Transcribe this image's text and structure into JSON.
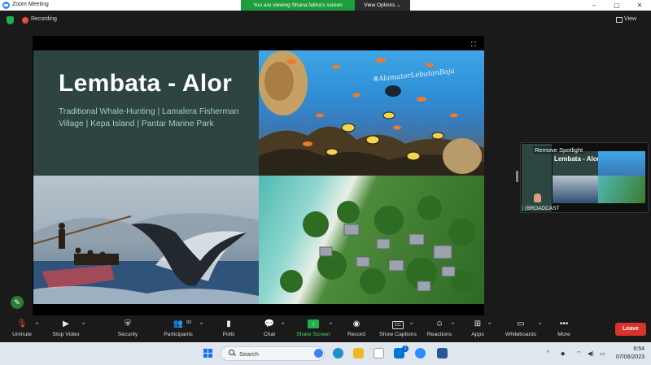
{
  "window": {
    "title": "Zoom Meeting"
  },
  "banner": {
    "text": "You are viewing Shana fatina's screen",
    "options_label": "View Options"
  },
  "status": {
    "recording_label": "Recording",
    "view_label": "View"
  },
  "slide": {
    "title": "Lembata - Alor",
    "subtitle": "Traditional Whale-Hunting | Lamalera Fisherman Village | Kepa Island | Pantar Marine Park",
    "reef_caption": "#AlamatorLebatanBaja"
  },
  "spotlight": {
    "remove_label": "Remove Spotlight",
    "thumb_title": "Lembata - Alor",
    "participant_name": "BROADCAST"
  },
  "toolbar": {
    "unmute": "Unmute",
    "stop_video": "Stop Video",
    "security": "Security",
    "participants": "Participants",
    "participants_count": "93",
    "polls": "Polls",
    "chat": "Chat",
    "share_screen": "Share Screen",
    "record": "Record",
    "show_captions": "Show Captions",
    "cc_badge": "CC",
    "reactions": "Reactions",
    "apps": "Apps",
    "whiteboards": "Whiteboards",
    "more": "More",
    "leave": "Leave"
  },
  "taskbar": {
    "search_label": "Search",
    "time": "9:54",
    "date": "07/06/2023",
    "mail_badge": "1"
  },
  "colors": {
    "share_green": "#1f9d3a",
    "leave_red": "#d9342b",
    "slide_panel": "#2d4441",
    "slide_subtitle": "#9fd0c7",
    "zoom_blue": "#2d8cff"
  }
}
